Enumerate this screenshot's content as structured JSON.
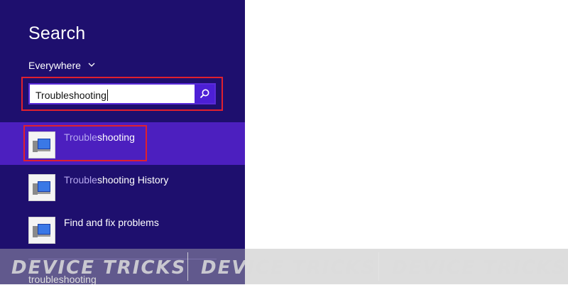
{
  "search_panel": {
    "title": "Search",
    "scope": "Everywhere",
    "query": "Troubleshooting",
    "results": [
      {
        "match": "Trouble",
        "rest": "shooting"
      },
      {
        "match": "Trouble",
        "rest": "shooting History"
      },
      {
        "match": "",
        "rest": "Find and fix problems"
      }
    ],
    "suggestion": "troubleshooting"
  },
  "watermark": {
    "text": "DEVICE TRICKS"
  },
  "colors": {
    "panel_bg": "#1e0f6e",
    "selected_bg": "#4c1fbf",
    "highlight_outline": "#e0202e",
    "search_button": "#4d1fd6"
  },
  "icons": {
    "search_button": "magnifier-icon",
    "scope_dropdown": "chevron-down-icon",
    "result": "troubleshooting-icon"
  }
}
